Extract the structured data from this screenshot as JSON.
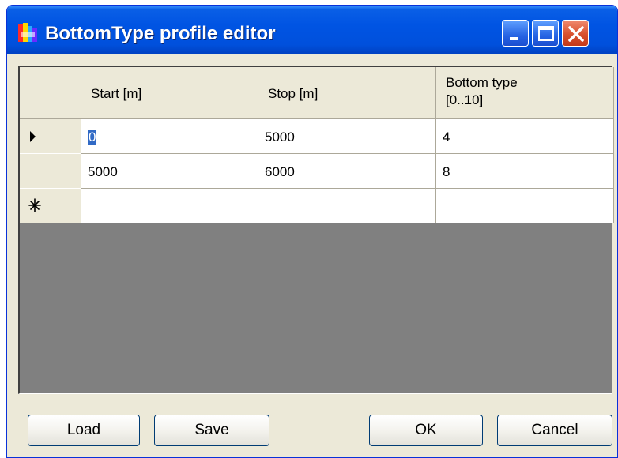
{
  "window": {
    "title": "BottomType profile editor"
  },
  "grid": {
    "columns": [
      {
        "label": "Start [m]"
      },
      {
        "label": "Stop [m]"
      },
      {
        "label_line1": "Bottom type",
        "label_line2": "[0..10]"
      }
    ],
    "rows": [
      {
        "indicator": "current-row",
        "start": "0",
        "stop": "5000",
        "bottom_type": "4"
      },
      {
        "indicator": "",
        "start": "5000",
        "stop": "6000",
        "bottom_type": "8"
      },
      {
        "indicator": "new-row",
        "start": "",
        "stop": "",
        "bottom_type": ""
      }
    ],
    "selected_cell": "rows.0.start"
  },
  "buttons": {
    "load": "Load",
    "save": "Save",
    "ok": "OK",
    "cancel": "Cancel"
  },
  "colors": {
    "titlebar": "#0054e3",
    "window_face": "#ece9d8",
    "grid_background": "#808080",
    "selection": "#316ac5"
  }
}
